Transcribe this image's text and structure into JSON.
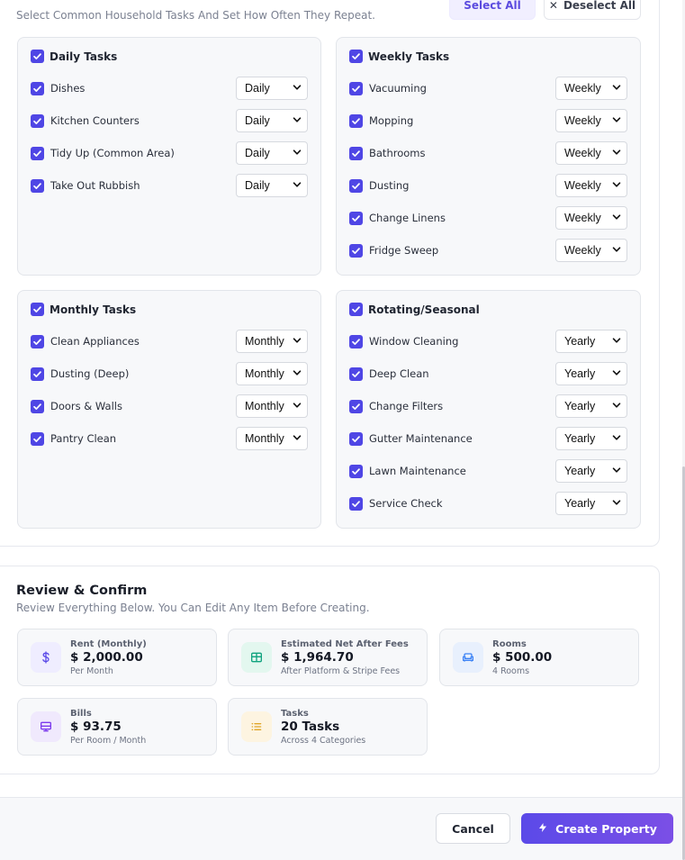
{
  "tasks_section": {
    "subtitle": "Select Common Household Tasks And Set How Often They Repeat.",
    "select_all_label": "Select All",
    "deselect_all_label": "Deselect All",
    "categories": [
      {
        "title": "Daily Tasks",
        "checked": true,
        "tasks": [
          {
            "label": "Dishes",
            "frequency": "Daily",
            "checked": true
          },
          {
            "label": "Kitchen Counters",
            "frequency": "Daily",
            "checked": true
          },
          {
            "label": "Tidy Up (Common Area)",
            "frequency": "Daily",
            "checked": true
          },
          {
            "label": "Take Out Rubbish",
            "frequency": "Daily",
            "checked": true
          }
        ]
      },
      {
        "title": "Weekly Tasks",
        "checked": true,
        "tasks": [
          {
            "label": "Vacuuming",
            "frequency": "Weekly",
            "checked": true
          },
          {
            "label": "Mopping",
            "frequency": "Weekly",
            "checked": true
          },
          {
            "label": "Bathrooms",
            "frequency": "Weekly",
            "checked": true
          },
          {
            "label": "Dusting",
            "frequency": "Weekly",
            "checked": true
          },
          {
            "label": "Change Linens",
            "frequency": "Weekly",
            "checked": true
          },
          {
            "label": "Fridge Sweep",
            "frequency": "Weekly",
            "checked": true
          }
        ]
      },
      {
        "title": "Monthly Tasks",
        "checked": true,
        "tasks": [
          {
            "label": "Clean Appliances",
            "frequency": "Monthly",
            "checked": true
          },
          {
            "label": "Dusting (Deep)",
            "frequency": "Monthly",
            "checked": true
          },
          {
            "label": "Doors & Walls",
            "frequency": "Monthly",
            "checked": true
          },
          {
            "label": "Pantry Clean",
            "frequency": "Monthly",
            "checked": true
          }
        ]
      },
      {
        "title": "Rotating/Seasonal",
        "checked": true,
        "tasks": [
          {
            "label": "Window Cleaning",
            "frequency": "Yearly",
            "checked": true
          },
          {
            "label": "Deep Clean",
            "frequency": "Yearly",
            "checked": true
          },
          {
            "label": "Change Filters",
            "frequency": "Yearly",
            "checked": true
          },
          {
            "label": "Gutter Maintenance",
            "frequency": "Yearly",
            "checked": true
          },
          {
            "label": "Lawn Maintenance",
            "frequency": "Yearly",
            "checked": true
          },
          {
            "label": "Service Check",
            "frequency": "Yearly",
            "checked": true
          }
        ]
      }
    ]
  },
  "review": {
    "title": "Review & Confirm",
    "subtitle": "Review Everything Below. You Can Edit Any Item Before Creating.",
    "stats": [
      {
        "icon": "dollar-icon",
        "label": "Rent (Monthly)",
        "value": "$ 2,000.00",
        "note": "Per Month",
        "accent": "#5b4ae8",
        "tint": "#efedff"
      },
      {
        "icon": "table-icon",
        "label": "Estimated Net After Fees",
        "value": "$ 1,964.70",
        "note": "After Platform & Stripe Fees",
        "accent": "#10a37f",
        "tint": "#e3f7ef"
      },
      {
        "icon": "sofa-icon",
        "label": "Rooms",
        "value": "$ 500.00",
        "note": "4 Rooms",
        "accent": "#3b82f6",
        "tint": "#e8f0fd"
      },
      {
        "icon": "monitor-icon",
        "label": "Bills",
        "value": "$ 93.75",
        "note": "Per Room / Month",
        "accent": "#7c3aed",
        "tint": "#f0e9fd"
      },
      {
        "icon": "list-icon",
        "label": "Tasks",
        "value": "20 Tasks",
        "note": "Across 4 Categories",
        "accent": "#e0a526",
        "tint": "#fdf4e1"
      }
    ]
  },
  "footer": {
    "cancel_label": "Cancel",
    "create_label": "Create Property"
  },
  "colors": {
    "accent": "#4f46e5",
    "primary_gradient_start": "#5b4ae8",
    "primary_gradient_end": "#7b4fe6"
  }
}
